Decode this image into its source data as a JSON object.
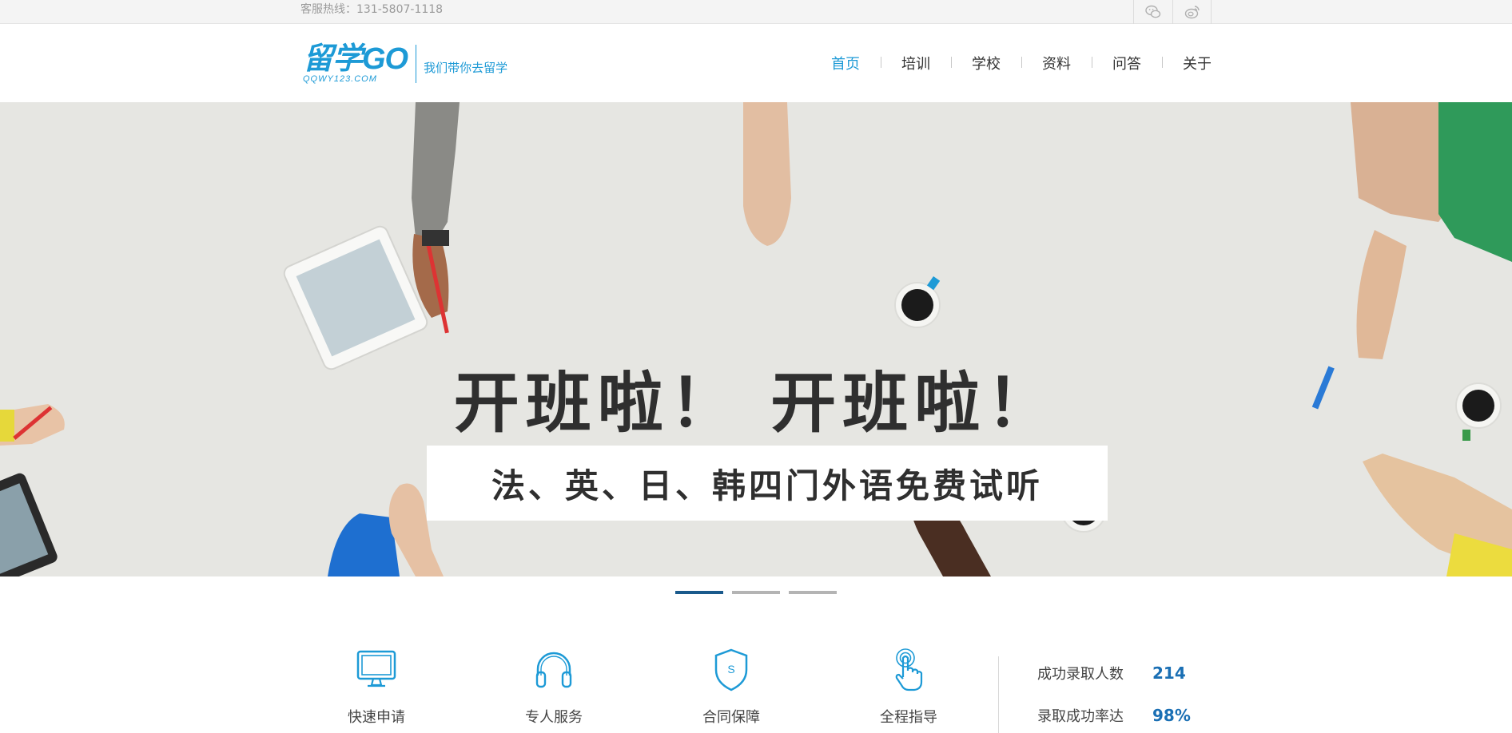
{
  "topbar": {
    "hotline": "客服热线：131-5807-1118",
    "social": [
      {
        "icon": "wechat-icon"
      },
      {
        "icon": "weibo-icon"
      }
    ]
  },
  "header": {
    "logo": {
      "name": "留学GO",
      "domain": "QQWY123.COM",
      "slogan": "我们带你去留学"
    },
    "nav": [
      {
        "label": "首页",
        "active": true
      },
      {
        "label": "培训",
        "active": false
      },
      {
        "label": "学校",
        "active": false
      },
      {
        "label": "资料",
        "active": false
      },
      {
        "label": "问答",
        "active": false
      },
      {
        "label": "关于",
        "active": false
      }
    ]
  },
  "banner": {
    "headline": "开班啦！ 开班啦！",
    "subline": "法、英、日、韩四门外语免费试听",
    "slides": 3,
    "active_slide": 1
  },
  "features": [
    {
      "label": "快速申请",
      "icon": "monitor-icon"
    },
    {
      "label": "专人服务",
      "icon": "headphones-icon"
    },
    {
      "label": "合同保障",
      "icon": "shield-icon"
    },
    {
      "label": "全程指导",
      "icon": "touch-hand-icon"
    }
  ],
  "stats": [
    {
      "label": "成功录取人数",
      "value": "214"
    },
    {
      "label": "录取成功率达",
      "value": "98%"
    }
  ],
  "colors": {
    "brand_blue": "#1d9ad6",
    "stat_blue": "#1a6fb4",
    "dot_active": "#1a5a8c",
    "banner_bg": "#e6e6e2"
  }
}
